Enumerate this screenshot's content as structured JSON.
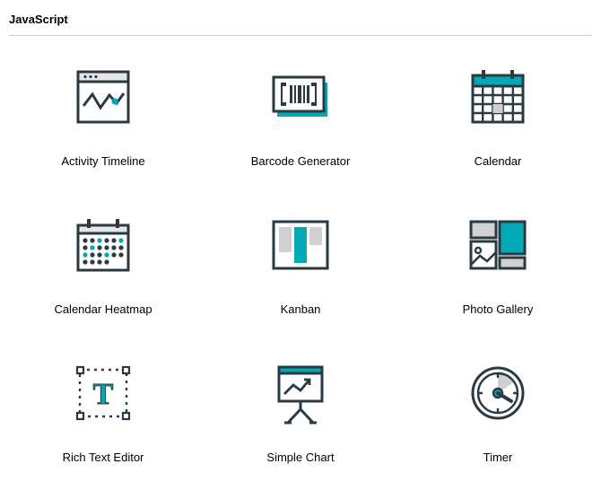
{
  "section_title": "JavaScript",
  "colors": {
    "stroke": "#2b3a42",
    "accent": "#00a9b5"
  },
  "items": [
    {
      "label": "Activity Timeline"
    },
    {
      "label": "Barcode Generator"
    },
    {
      "label": "Calendar"
    },
    {
      "label": "Calendar Heatmap"
    },
    {
      "label": "Kanban"
    },
    {
      "label": "Photo Gallery"
    },
    {
      "label": "Rich Text Editor"
    },
    {
      "label": "Simple Chart"
    },
    {
      "label": "Timer"
    }
  ]
}
